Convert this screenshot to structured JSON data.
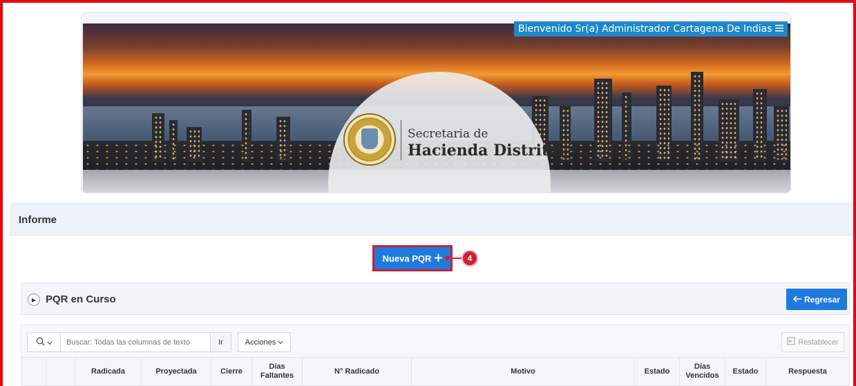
{
  "header": {
    "welcome_text": "Bienvenido Sr(a) Administrador Cartagena De Indias",
    "menu_icon": "hamburger-icon",
    "logo_line1": "Secretaria de",
    "logo_line2": "Hacienda Distrital",
    "seal_icon": "city-seal-icon"
  },
  "informe": {
    "title": "Informe"
  },
  "actions": {
    "nueva_pqr_label": "Nueva PQR",
    "nueva_pqr_icon": "plus-icon",
    "callout_number": "4"
  },
  "pqr_region": {
    "title": "PQR en Curso",
    "regresar_label": "Regresar",
    "regresar_icon": "arrow-left-icon"
  },
  "toolbar": {
    "search_placeholder": "Buscar: Todas las columnas de texto",
    "go_label": "Ir",
    "acciones_label": "Acciones",
    "restablecer_label": "Restablecer"
  },
  "grid": {
    "columns": [
      "",
      "",
      "Radicada",
      "Proyectada",
      "Cierre",
      "Días Faltantes",
      "N° Radicado",
      "Motivo",
      "Estado",
      "Días Vencidos",
      "Estado",
      "Respuesta"
    ]
  },
  "colors": {
    "primary": "#1f7ae0",
    "highlight_red": "#cc1f2d",
    "welcome_bg": "#1e88c8"
  }
}
